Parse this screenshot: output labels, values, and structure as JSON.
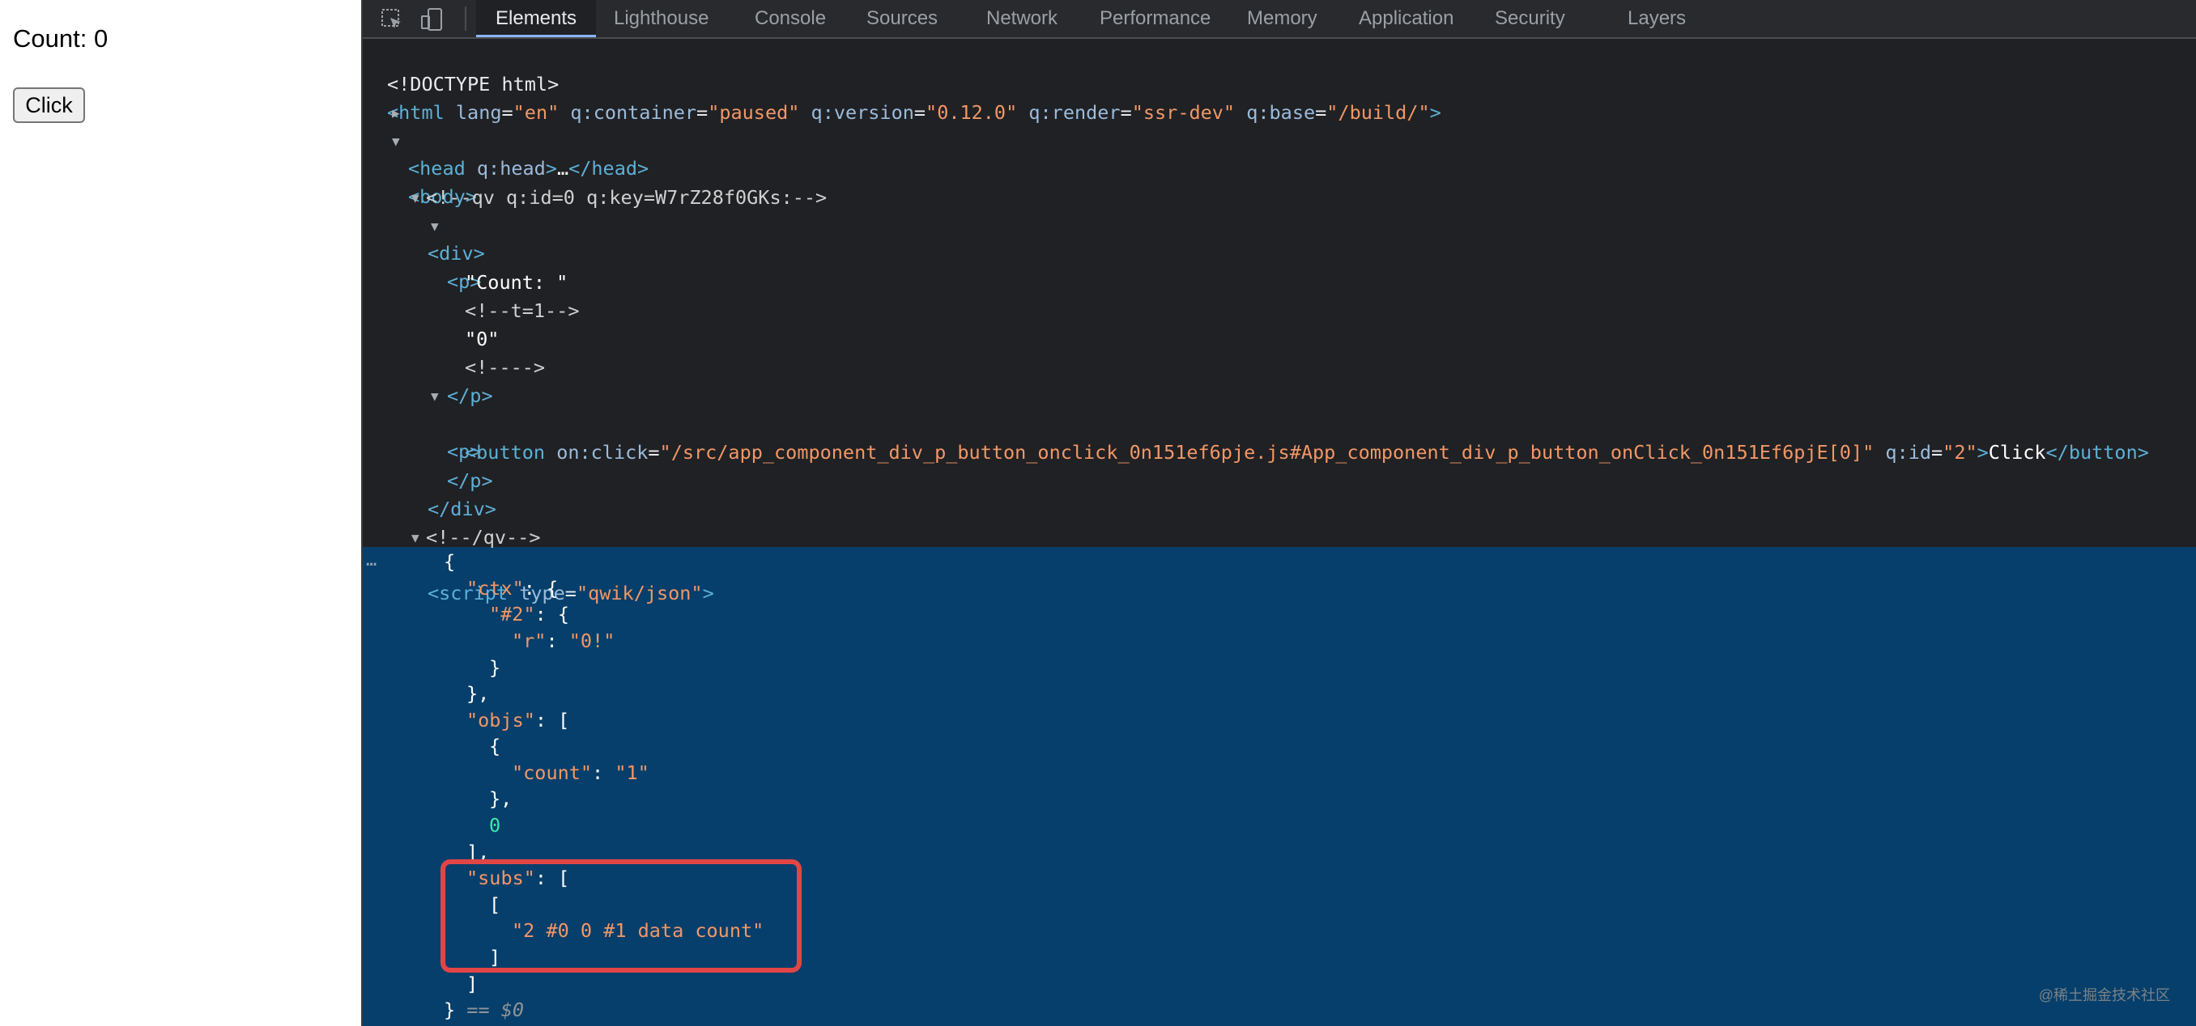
{
  "page": {
    "count_text": "Count: 0",
    "button_label": "Click"
  },
  "devtools": {
    "tabs": [
      "Elements",
      "Lighthouse",
      "Console",
      "Sources",
      "Network",
      "Performance",
      "Memory",
      "Application",
      "Security",
      "Layers"
    ],
    "active_tab": "Elements",
    "icons": [
      "inspect-element-icon",
      "device-toolbar-icon"
    ]
  },
  "dom": {
    "doctype": "<!DOCTYPE html>",
    "html_lang": "\"en\"",
    "html_container": "\"paused\"",
    "html_version": "\"0.12.0\"",
    "html_render": "\"ssr-dev\"",
    "html_base": "\"/build/\"",
    "head_attr": "q:head",
    "head_ellipsis": "…",
    "comment_qv": "<!--qv q:id=0 q:key=W7rZ28f0GKs:-->",
    "text_count": "\"Count: \"",
    "comment_t1": "<!--t=1-->",
    "text_zero": "\"0\"",
    "comment_empty": "<!---->",
    "button_onclick_attr": "on:click",
    "button_onclick": "\"/src/app_component_div_p_button_onclick_0n151ef6pje.js#App_component_div_p_button_onClick_0n151Ef6pjE[0]\"",
    "button_qid_attr": "q:id",
    "button_qid": "\"2\"",
    "button_text": "Click",
    "comment_qv_end": "<!--/qv-->",
    "script_type": "\"qwik/json\""
  },
  "json_dump": {
    "ellipsis": "…",
    "ctx_key": "\"ctx\"",
    "ctx_sub_key": "\"#2\"",
    "r_key": "\"r\"",
    "r_val": "\"0!\"",
    "objs_key": "\"objs\"",
    "count_key": "\"count\"",
    "count_val": "\"1\"",
    "zero": "0",
    "subs_key": "\"subs\"",
    "subs_val": "\"2 #0 0 #1 data count\"",
    "selection_marker": "== $0"
  },
  "watermark": "@稀土掘金技术社区",
  "colors": {
    "selection_bg": "#063f6b",
    "highlight_border": "#e24545",
    "active_tab_underline": "#8ab4f8"
  }
}
